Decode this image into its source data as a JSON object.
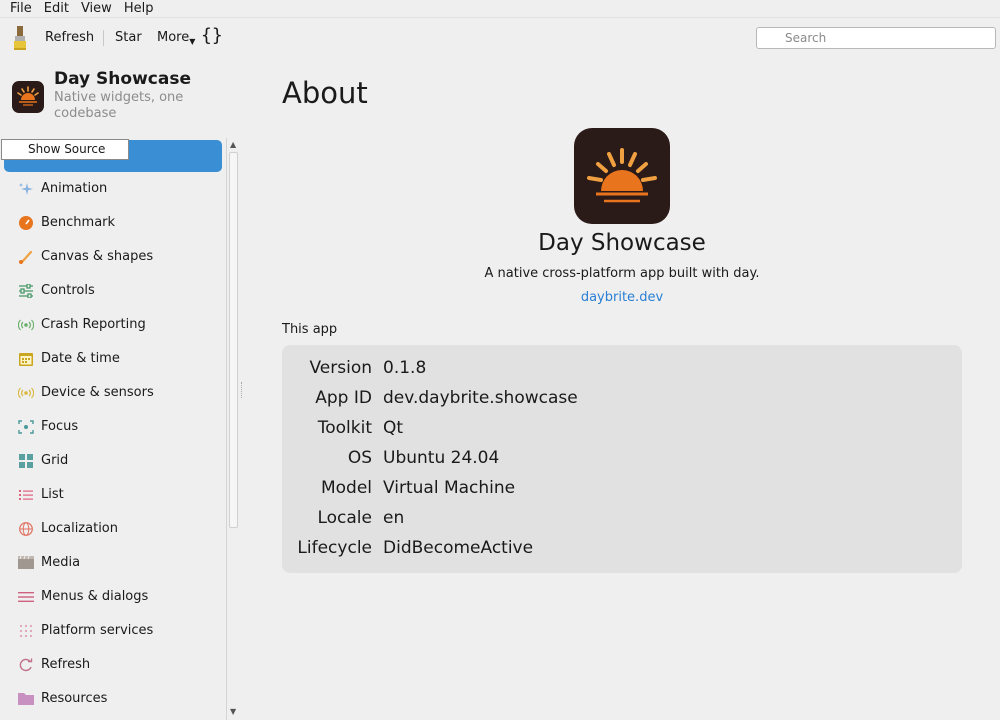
{
  "menubar": {
    "items": [
      "File",
      "Edit",
      "View",
      "Help"
    ]
  },
  "toolbar": {
    "refresh": "Refresh",
    "star": "Star",
    "more": "More",
    "source_icon": "{}",
    "search_placeholder": "Search"
  },
  "sidebar": {
    "title": "Day Showcase",
    "subtitle": "Native widgets, one codebase",
    "tooltip": "Show Source",
    "items": [
      {
        "label": "Animation",
        "icon": "sparkle-icon"
      },
      {
        "label": "Benchmark",
        "icon": "gauge-icon"
      },
      {
        "label": "Canvas & shapes",
        "icon": "brush-icon"
      },
      {
        "label": "Controls",
        "icon": "sliders-icon"
      },
      {
        "label": "Crash Reporting",
        "icon": "signal-icon"
      },
      {
        "label": "Date & time",
        "icon": "calendar-icon"
      },
      {
        "label": "Device & sensors",
        "icon": "sensor-icon"
      },
      {
        "label": "Focus",
        "icon": "focus-icon"
      },
      {
        "label": "Grid",
        "icon": "grid-icon"
      },
      {
        "label": "List",
        "icon": "list-icon"
      },
      {
        "label": "Localization",
        "icon": "globe-icon"
      },
      {
        "label": "Media",
        "icon": "film-icon"
      },
      {
        "label": "Menus & dialogs",
        "icon": "menu-icon"
      },
      {
        "label": "Platform services",
        "icon": "dots-grid-icon"
      },
      {
        "label": "Refresh",
        "icon": "refresh-icon"
      },
      {
        "label": "Resources",
        "icon": "folder-icon"
      }
    ]
  },
  "main": {
    "title": "About",
    "app_name": "Day Showcase",
    "description": "A native cross-platform app built with day.",
    "link": "daybrite.dev",
    "section": "This app",
    "info": [
      {
        "key": "Version",
        "value": "0.1.8"
      },
      {
        "key": "App ID",
        "value": "dev.daybrite.showcase"
      },
      {
        "key": "Toolkit",
        "value": "Qt"
      },
      {
        "key": "OS",
        "value": "Ubuntu 24.04"
      },
      {
        "key": "Model",
        "value": "Virtual Machine"
      },
      {
        "key": "Locale",
        "value": "en"
      },
      {
        "key": "Lifecycle",
        "value": "DidBecomeActive"
      }
    ]
  },
  "colors": {
    "accent": "#3a8fd4",
    "link": "#2a7fd4",
    "panel": "#e1e1e1",
    "icon_bg": "#2a1a18",
    "sun": "#e8741e"
  }
}
